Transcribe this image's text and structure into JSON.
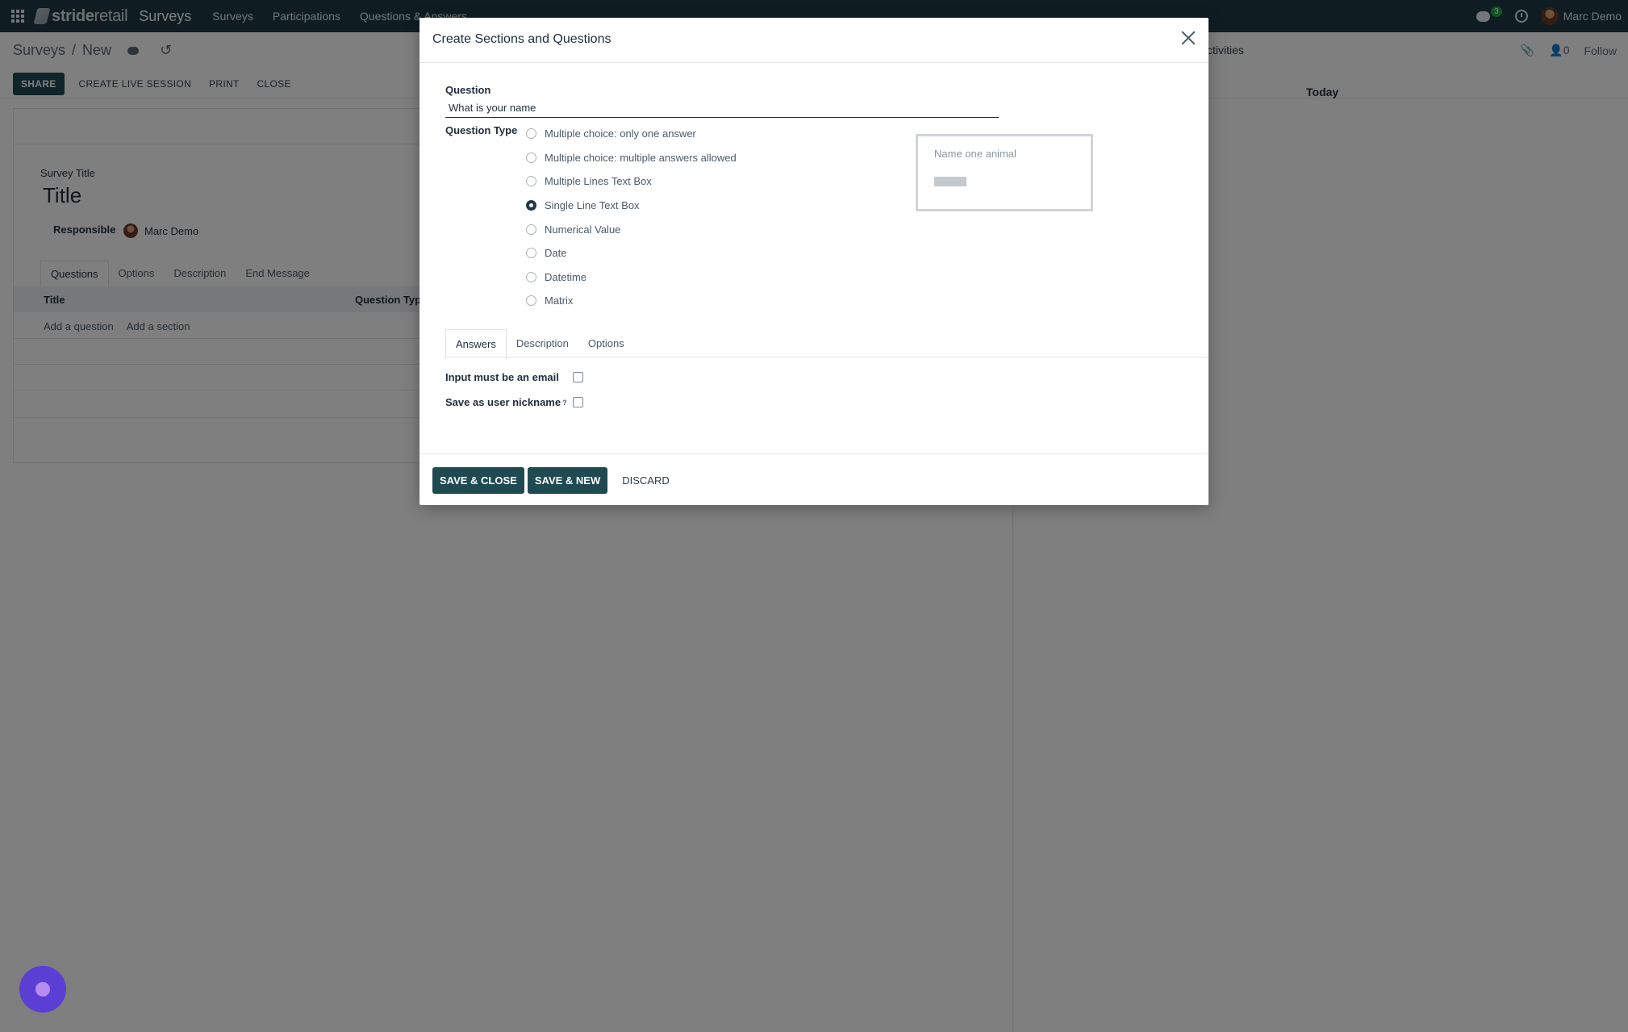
{
  "navbar": {
    "brand_prefix": "stride",
    "brand_suffix": "retail",
    "app_name": "Surveys",
    "menu": [
      "Surveys",
      "Participations",
      "Questions & Answers"
    ],
    "chat_count": "3",
    "user_name": "Marc Demo"
  },
  "control_panel": {
    "breadcrumb_root": "Surveys",
    "breadcrumb_sep": "/",
    "breadcrumb_current": "New",
    "buttons": {
      "share": "SHARE",
      "live_session": "CREATE LIVE SESSION",
      "print": "PRINT",
      "close": "CLOSE"
    },
    "activities": "ctivities",
    "followers": "0",
    "follow": "Follow"
  },
  "form": {
    "survey_title_label": "Survey Title",
    "title_value": "Title",
    "responsible_label": "Responsible",
    "responsible_value": "Marc Demo",
    "tabs": [
      "Questions",
      "Options",
      "Description",
      "End Message"
    ],
    "columns": [
      "Title",
      "Question Type"
    ],
    "add_question": "Add a question",
    "add_section": "Add a section"
  },
  "chatter": {
    "today": "Today"
  },
  "modal": {
    "title": "Create Sections and Questions",
    "question_label": "Question",
    "question_value": "What is your name",
    "question_type_label": "Question Type",
    "question_types": [
      "Multiple choice: only one answer",
      "Multiple choice: multiple answers allowed",
      "Multiple Lines Text Box",
      "Single Line Text Box",
      "Numerical Value",
      "Date",
      "Datetime",
      "Matrix"
    ],
    "selected_type": "Single Line Text Box",
    "preview_placeholder": "Name one animal",
    "tabs": [
      "Answers",
      "Description",
      "Options"
    ],
    "opt_email": "Input must be an email",
    "opt_nickname": "Save as user nickname",
    "opt_help": "?",
    "footer": {
      "save_close": "SAVE & CLOSE",
      "save_new": "SAVE & NEW",
      "discard": "DISCARD"
    }
  }
}
